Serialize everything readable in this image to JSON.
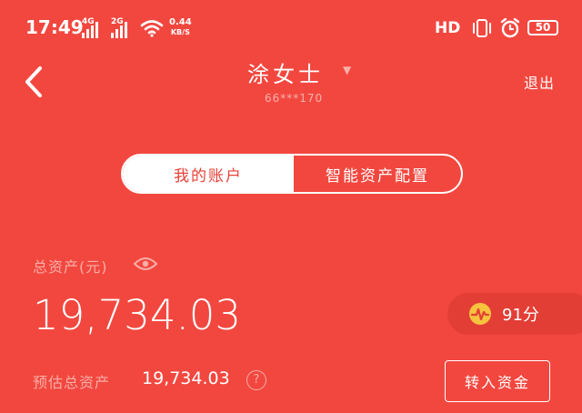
{
  "status_bar": {
    "time": "17:49",
    "signal1_type": "4G",
    "signal2_type": "2G",
    "net_speed_value": "0.44",
    "net_speed_unit": "KB/S",
    "hd_label": "HD",
    "battery": "50",
    "icons": [
      "signal-icon",
      "wifi-icon",
      "vibrate-icon",
      "alarm-icon",
      "battery-icon"
    ]
  },
  "header": {
    "back_icon": "chevron-left-icon",
    "user_name": "涂女士",
    "dropdown_icon": "triangle-down-icon",
    "phone_masked": "66***170",
    "logout_label": "退出"
  },
  "tabs": [
    {
      "label": "我的账户",
      "active": true
    },
    {
      "label": "智能资产配置",
      "active": false
    }
  ],
  "assets": {
    "total_label": "总资产(元)",
    "visibility_icon": "eye-icon",
    "total_value": "19,734.03",
    "score_icon": "health-score-icon",
    "score_text": "91分",
    "estimated_label": "预估总资产",
    "estimated_value": "19,734.03",
    "help_icon_glyph": "?",
    "transfer_button_label": "转入资金"
  },
  "colors": {
    "background": "#f2473f",
    "active_tab_text": "#e94037",
    "muted_text": "#f8aea8"
  }
}
